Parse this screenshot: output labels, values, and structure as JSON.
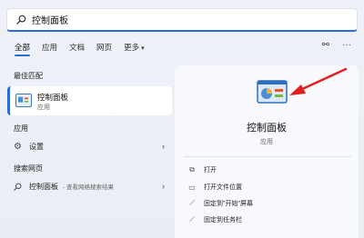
{
  "search": {
    "query": "控制面板"
  },
  "tabs": [
    {
      "label": "全部",
      "active": true
    },
    {
      "label": "应用"
    },
    {
      "label": "文档"
    },
    {
      "label": "网页"
    },
    {
      "label": "更多"
    }
  ],
  "sections": {
    "best_match": "最佳匹配",
    "apps": "应用",
    "web": "搜索网页"
  },
  "best_match": {
    "name": "控制面板",
    "type": "应用"
  },
  "apps": [
    {
      "label": "设置"
    }
  ],
  "web": [
    {
      "label": "控制面板",
      "sub": "- 查看网络搜索结果"
    }
  ],
  "detail": {
    "title": "控制面板",
    "type": "应用",
    "actions": [
      {
        "label": "打开",
        "icon": "open-icon"
      },
      {
        "label": "打开文件位置",
        "icon": "folder-icon"
      },
      {
        "label": "固定到\"开始\"屏幕",
        "icon": "pin-icon"
      },
      {
        "label": "固定到任务栏",
        "icon": "pin-icon"
      }
    ]
  },
  "colors": {
    "accent": "#2a6bd6",
    "annotation": "#e02020"
  }
}
